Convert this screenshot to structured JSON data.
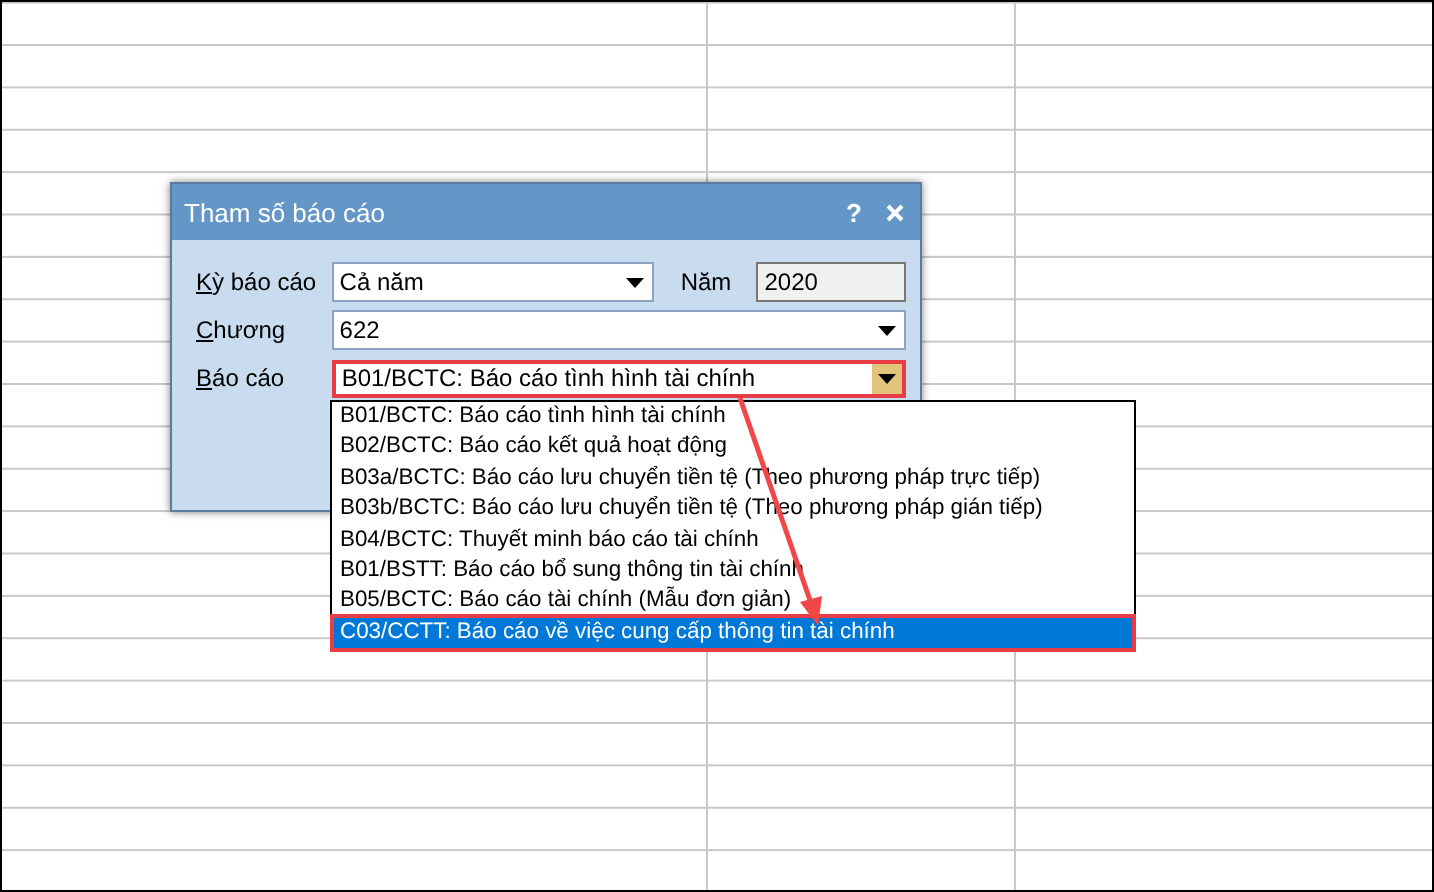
{
  "dialog": {
    "title": "Tham số báo cáo",
    "help": "?",
    "period": {
      "label": "Kỳ báo cáo",
      "value": "Cả năm"
    },
    "year": {
      "label": "Năm",
      "value": "2020"
    },
    "chapter": {
      "label": "Chương",
      "value": "622"
    },
    "report": {
      "label": "Báo cáo",
      "value": "B01/BCTC: Báo cáo tình hình tài chính",
      "highlighted": true,
      "expanded": true
    }
  },
  "report_options": [
    {
      "label": "B01/BCTC: Báo cáo tình hình tài chính",
      "selected": false
    },
    {
      "label": "B02/BCTC: Báo cáo kết quả hoạt động",
      "selected": false
    },
    {
      "label": "B03a/BCTC: Báo cáo lưu chuyển tiền tệ (Theo phương pháp trực tiếp)",
      "selected": false
    },
    {
      "label": "B03b/BCTC: Báo cáo lưu chuyển tiền tệ (Theo phương pháp gián tiếp)",
      "selected": false
    },
    {
      "label": "B04/BCTC: Thuyết minh báo cáo tài chính",
      "selected": false
    },
    {
      "label": "B01/BSTT: Báo cáo bổ sung thông tin tài chính",
      "selected": false
    },
    {
      "label": "B05/BCTC: Báo cáo tài chính (Mẫu đơn giản)",
      "selected": false
    },
    {
      "label": "C03/CCTT: Báo cáo về việc cung cấp thông tin tài chính",
      "selected": true
    }
  ],
  "annotation_arrow": true
}
